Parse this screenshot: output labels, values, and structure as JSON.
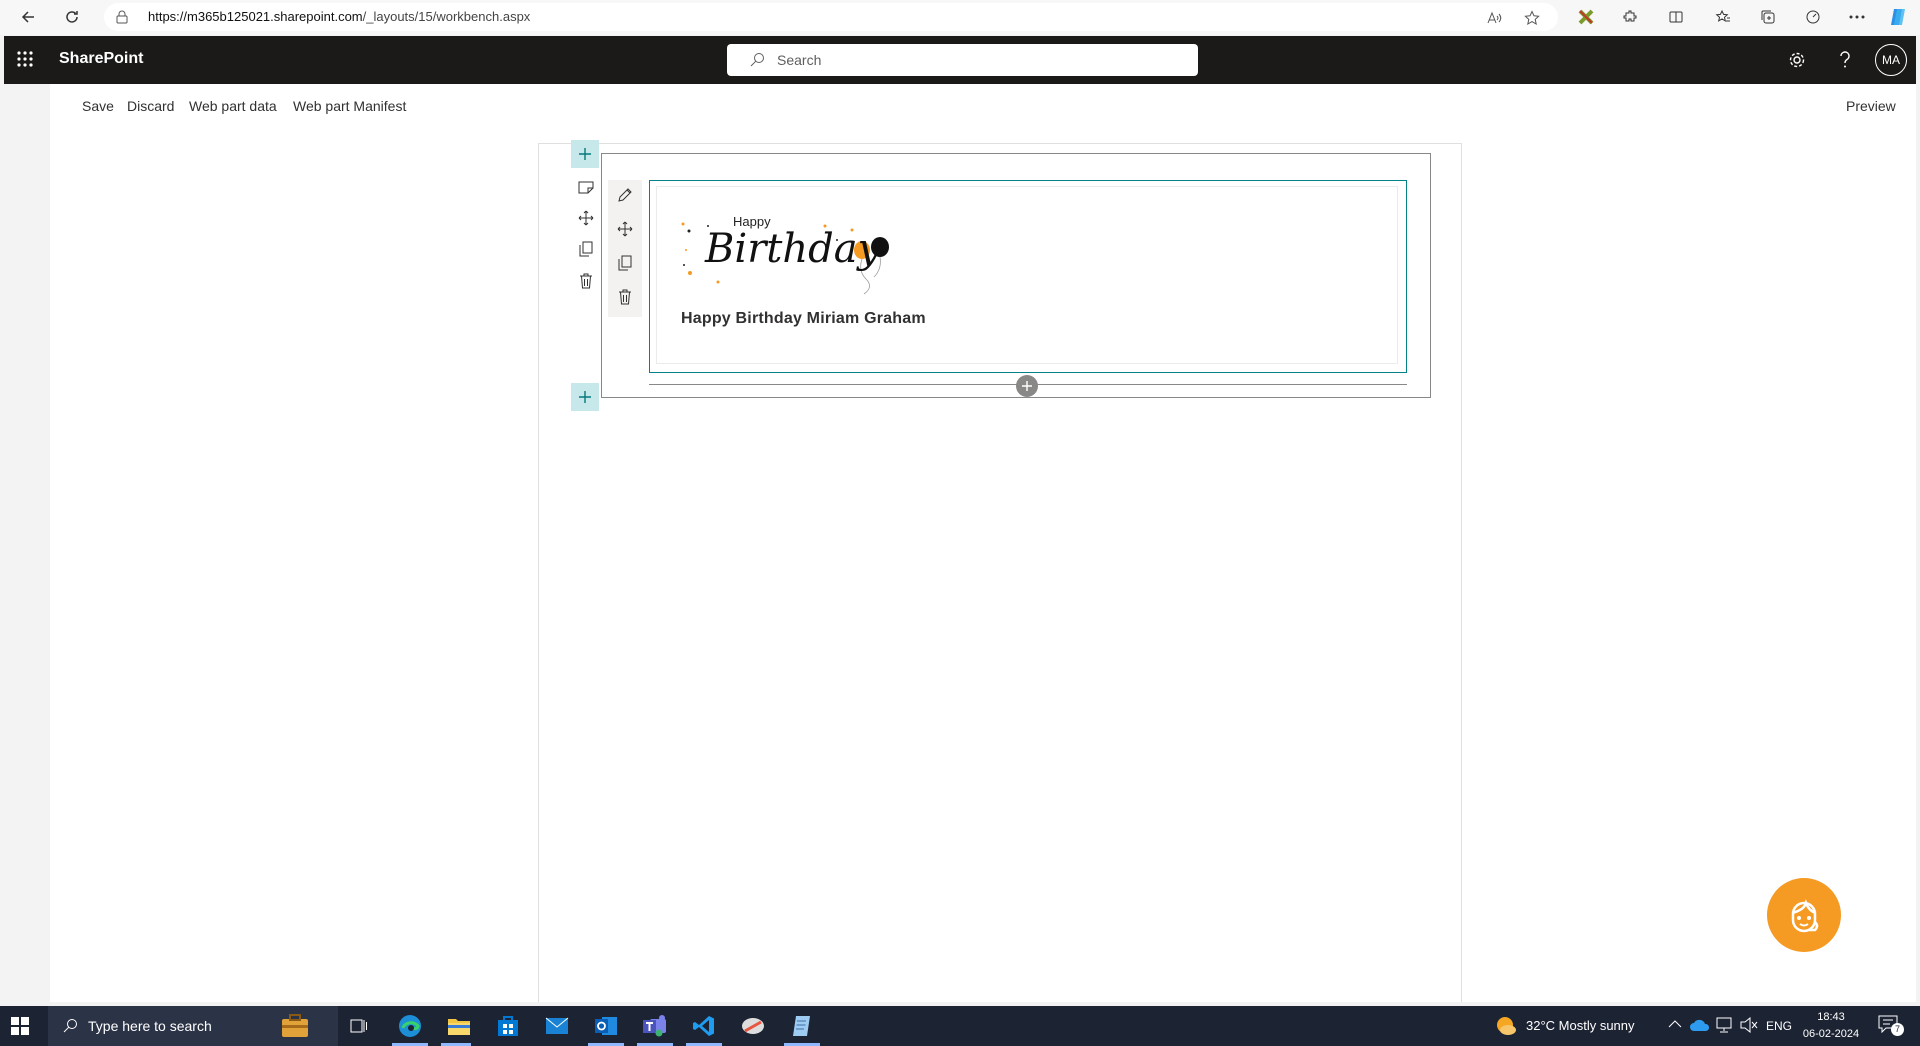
{
  "browser": {
    "url_host": "https://m365b125021.sharepoint.com",
    "url_path": "/_layouts/15/workbench.aspx"
  },
  "suite": {
    "brand": "SharePoint",
    "search_placeholder": "Search",
    "avatar_initials": "MA"
  },
  "commands": {
    "save": "Save",
    "discard": "Discard",
    "web_part_data": "Web part data",
    "web_part_manifest": "Web part Manifest",
    "preview": "Preview"
  },
  "webpart": {
    "image_happy": "Happy",
    "image_birthday": "Birthday",
    "greeting": "Happy Birthday Miriam Graham"
  },
  "taskbar": {
    "search_placeholder": "Type here to search",
    "weather": "32°C  Mostly sunny",
    "language": "ENG",
    "time": "18:43",
    "date": "06-02-2024",
    "notification_count": "7"
  },
  "colors": {
    "suite_bar": "#1b1a19",
    "accent_teal": "#038387",
    "bot": "#f59a23",
    "taskbar": "#1c2333"
  }
}
